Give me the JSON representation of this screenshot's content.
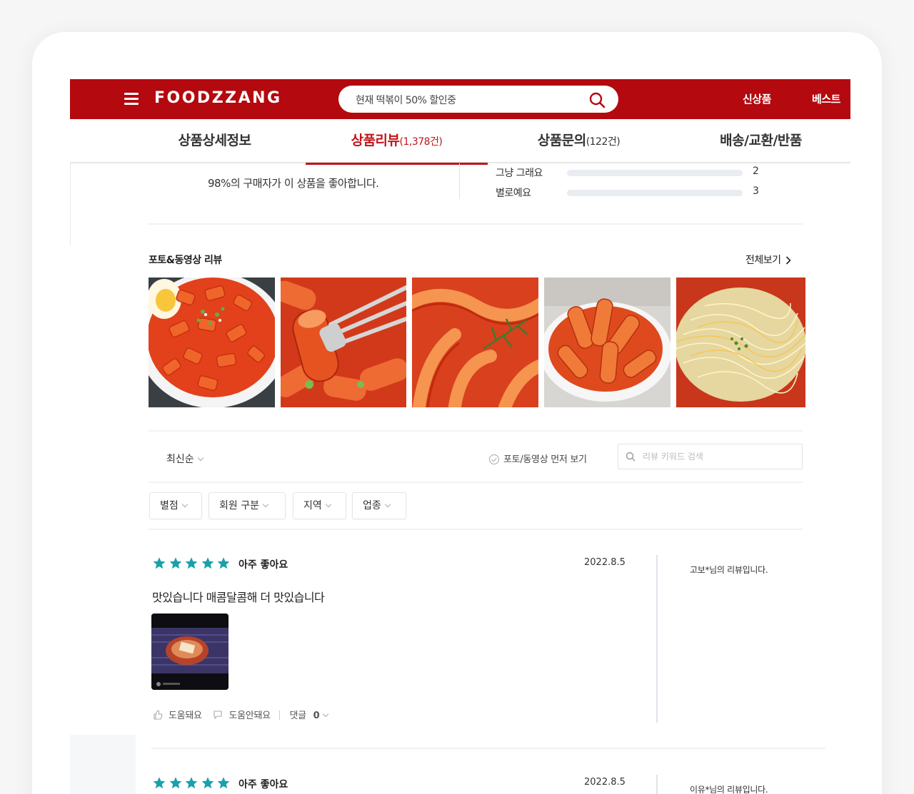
{
  "header": {
    "logo": "FOODZZANG",
    "search_text": "현재 떡볶이 50% 할인중",
    "nav": [
      "신상품",
      "베스트"
    ],
    "brand_color": "#b3090f"
  },
  "tabs": [
    {
      "label": "상품상세정보",
      "count": ""
    },
    {
      "label": "상품리뷰",
      "count": "(1,378건)"
    },
    {
      "label": "상품문의",
      "count": "(122건)"
    },
    {
      "label": "배송/교환/반품",
      "count": ""
    }
  ],
  "active_tab": 1,
  "summary": {
    "text": "98%의 구매자가 이 상품을 좋아합니다.",
    "ratings": [
      {
        "label": "그냥 그래요",
        "count": "2",
        "fraction": 0.0
      },
      {
        "label": "별로예요",
        "count": "3",
        "fraction": 0.0
      }
    ]
  },
  "photo_reviews": {
    "title": "포토&동영상 리뷰",
    "see_all": "전체보기"
  },
  "filters": {
    "sort": "최신순",
    "photo_first": "포토/동영상 먼저 보기",
    "search_placeholder": "리뷰 키워드 검색",
    "chips": [
      "별점",
      "회원 구분",
      "지역",
      "업종"
    ]
  },
  "reviews": [
    {
      "rating": 5,
      "label": "아주 좋아요",
      "date": "2022.8.5",
      "author": "고보*님의 리뷰입니다.",
      "body": "맛있습니다 매콤달콤해 더 맛있습니다",
      "helpful": "도움돼요",
      "not_helpful": "도움안돼요",
      "comments_label": "댓글",
      "comments_count": "0"
    },
    {
      "rating": 5,
      "label": "아주 좋아요",
      "date": "2022.8.5",
      "author": "이유*님의 리뷰입니다."
    }
  ],
  "colors": {
    "star": "#1aa0aa",
    "accent": "#c1141a"
  }
}
